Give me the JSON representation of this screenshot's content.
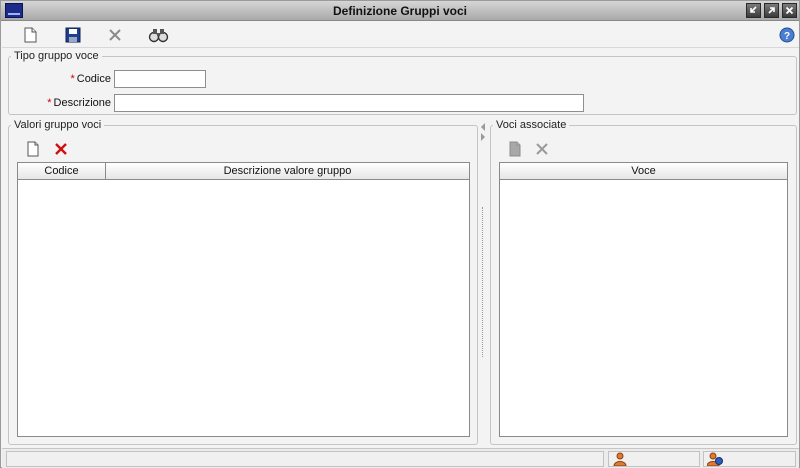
{
  "window": {
    "title": "Definizione Gruppi voci",
    "logo_icon": "application-logo",
    "controls": [
      "minimize-icon",
      "maximize-icon",
      "close-icon"
    ]
  },
  "toolbar": {
    "buttons": [
      {
        "icon": "new-document-icon",
        "enabled": true
      },
      {
        "icon": "save-disk-icon",
        "enabled": true
      },
      {
        "icon": "delete-x-icon",
        "enabled": false
      },
      {
        "icon": "binoculars-search-icon",
        "enabled": true
      }
    ],
    "help_icon": "help-icon"
  },
  "tipo_gruppo": {
    "title": "Tipo gruppo voce",
    "required_marker": "*",
    "codice_label": "Codice",
    "codice_value": "",
    "descrizione_label": "Descrizione",
    "descrizione_value": ""
  },
  "valori": {
    "title": "Valori gruppo voci",
    "toolbar_icons": [
      "new-document-icon",
      "delete-red-x-icon"
    ],
    "columns": [
      "Codice",
      "Descrizione valore gruppo"
    ],
    "rows": []
  },
  "voci": {
    "title": "Voci associate",
    "toolbar_icons": [
      "new-document-disabled-icon",
      "delete-disabled-x-icon"
    ],
    "columns": [
      "Voce"
    ],
    "rows": []
  },
  "statusbar": {
    "message": "",
    "panel_icons": [
      "user-icon",
      "user-info-icon"
    ]
  },
  "colors": {
    "required": "#d00000",
    "delete_red": "#cc1111",
    "title_bar": "#a9a9a9",
    "logo_blue": "#1c2a8a"
  }
}
